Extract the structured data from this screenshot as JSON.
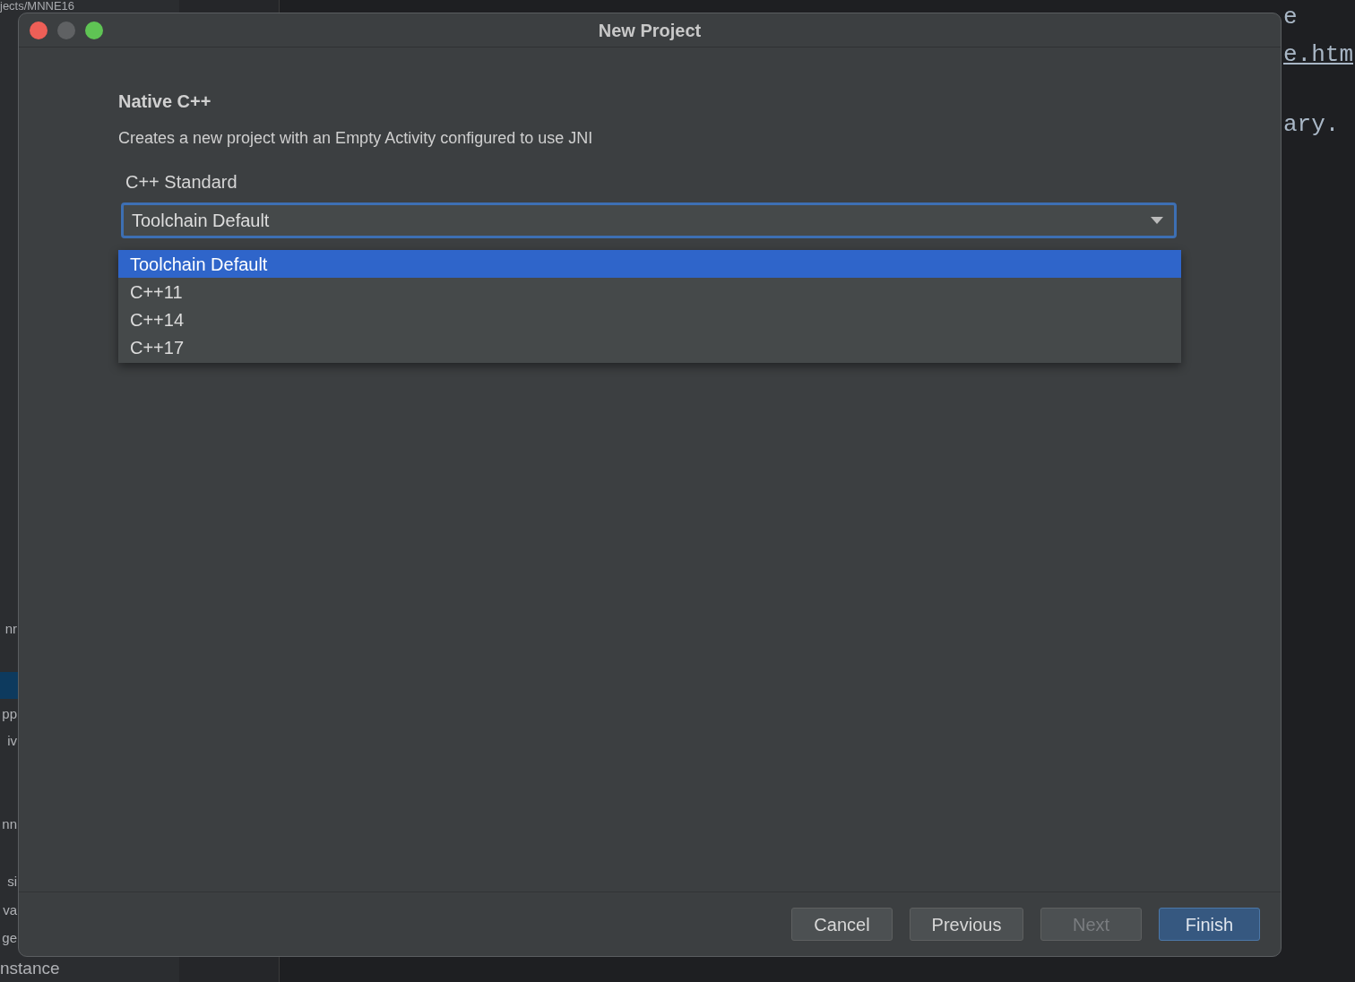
{
  "background": {
    "path_fragment": "jects/MNNE16",
    "sidebar_fragments": [
      "nr",
      "pp",
      "iv",
      "nn",
      "si",
      "va",
      "ge",
      "nstance"
    ],
    "editor_fragments": [
      {
        "text": "e",
        "kind": "plain"
      },
      {
        "text": "e.htm",
        "kind": "link"
      },
      {
        "text": "ary.",
        "kind": "plain"
      }
    ]
  },
  "window": {
    "title": "New Project"
  },
  "template": {
    "title": "Native C++",
    "description": "Creates a new project with an Empty Activity configured to use JNI"
  },
  "cpp_standard": {
    "label": "C++ Standard",
    "value": "Toolchain Default",
    "expanded": true,
    "options": [
      {
        "label": "Toolchain Default",
        "selected": true
      },
      {
        "label": "C++11",
        "selected": false
      },
      {
        "label": "C++14",
        "selected": false
      },
      {
        "label": "C++17",
        "selected": false
      }
    ]
  },
  "buttons": [
    {
      "label": "Cancel",
      "kind": "normal",
      "disabled": false
    },
    {
      "label": "Previous",
      "kind": "normal",
      "disabled": false
    },
    {
      "label": "Next",
      "kind": "normal",
      "disabled": true
    },
    {
      "label": "Finish",
      "kind": "default",
      "disabled": false
    }
  ]
}
